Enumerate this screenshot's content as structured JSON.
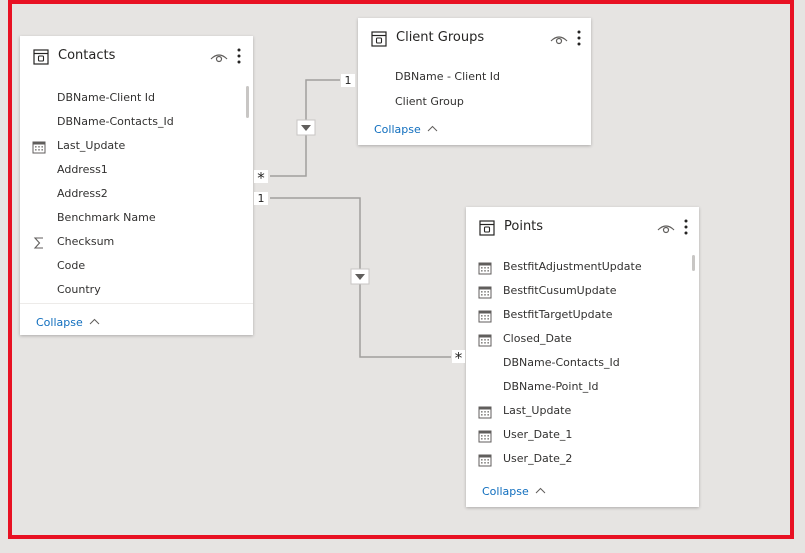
{
  "contacts": {
    "title": "Contacts",
    "icons": {
      "table": "table-icon",
      "visibility": "eye-icon",
      "more": "more-vertical-icon"
    },
    "fields": [
      {
        "label": "DBName-Client Id",
        "icon": ""
      },
      {
        "label": "DBName-Contacts_Id",
        "icon": ""
      },
      {
        "label": "Last_Update",
        "icon": "calendar-icon"
      },
      {
        "label": "Address1",
        "icon": ""
      },
      {
        "label": "Address2",
        "icon": ""
      },
      {
        "label": "Benchmark Name",
        "icon": ""
      },
      {
        "label": "Checksum",
        "icon": "sigma-icon"
      },
      {
        "label": "Code",
        "icon": ""
      },
      {
        "label": "Country",
        "icon": ""
      }
    ],
    "collapse_label": "Collapse"
  },
  "client_groups": {
    "title": "Client Groups",
    "icons": {
      "table": "table-icon",
      "visibility": "eye-icon",
      "more": "more-vertical-icon"
    },
    "fields": [
      {
        "label": "DBName - Client Id",
        "icon": ""
      },
      {
        "label": "Client Group",
        "icon": ""
      }
    ],
    "collapse_label": "Collapse"
  },
  "points": {
    "title": "Points",
    "icons": {
      "table": "table-icon",
      "visibility": "eye-icon",
      "more": "more-vertical-icon"
    },
    "fields": [
      {
        "label": "BestfitAdjustmentUpdate",
        "icon": "calendar-icon"
      },
      {
        "label": "BestfitCusumUpdate",
        "icon": "calendar-icon"
      },
      {
        "label": "BestfitTargetUpdate",
        "icon": "calendar-icon"
      },
      {
        "label": "Closed_Date",
        "icon": "calendar-icon"
      },
      {
        "label": "DBName-Contacts_Id",
        "icon": ""
      },
      {
        "label": "DBName-Point_Id",
        "icon": ""
      },
      {
        "label": "Last_Update",
        "icon": "calendar-icon"
      },
      {
        "label": "User_Date_1",
        "icon": "calendar-icon"
      },
      {
        "label": "User_Date_2",
        "icon": "calendar-icon"
      }
    ],
    "collapse_label": "Collapse"
  },
  "relationships": [
    {
      "from": "contacts",
      "to": "client_groups",
      "from_cardinality": "*",
      "to_cardinality": "1",
      "direction_icon": "arrow-down-icon"
    },
    {
      "from": "contacts",
      "to": "points",
      "from_cardinality": "1",
      "to_cardinality": "*",
      "direction_icon": "arrow-down-icon"
    }
  ],
  "colors": {
    "canvas": "#e6e4e2",
    "highlight_frame": "#e81123",
    "link_line": "#a19f9d",
    "collapse_link": "#106ebe"
  }
}
